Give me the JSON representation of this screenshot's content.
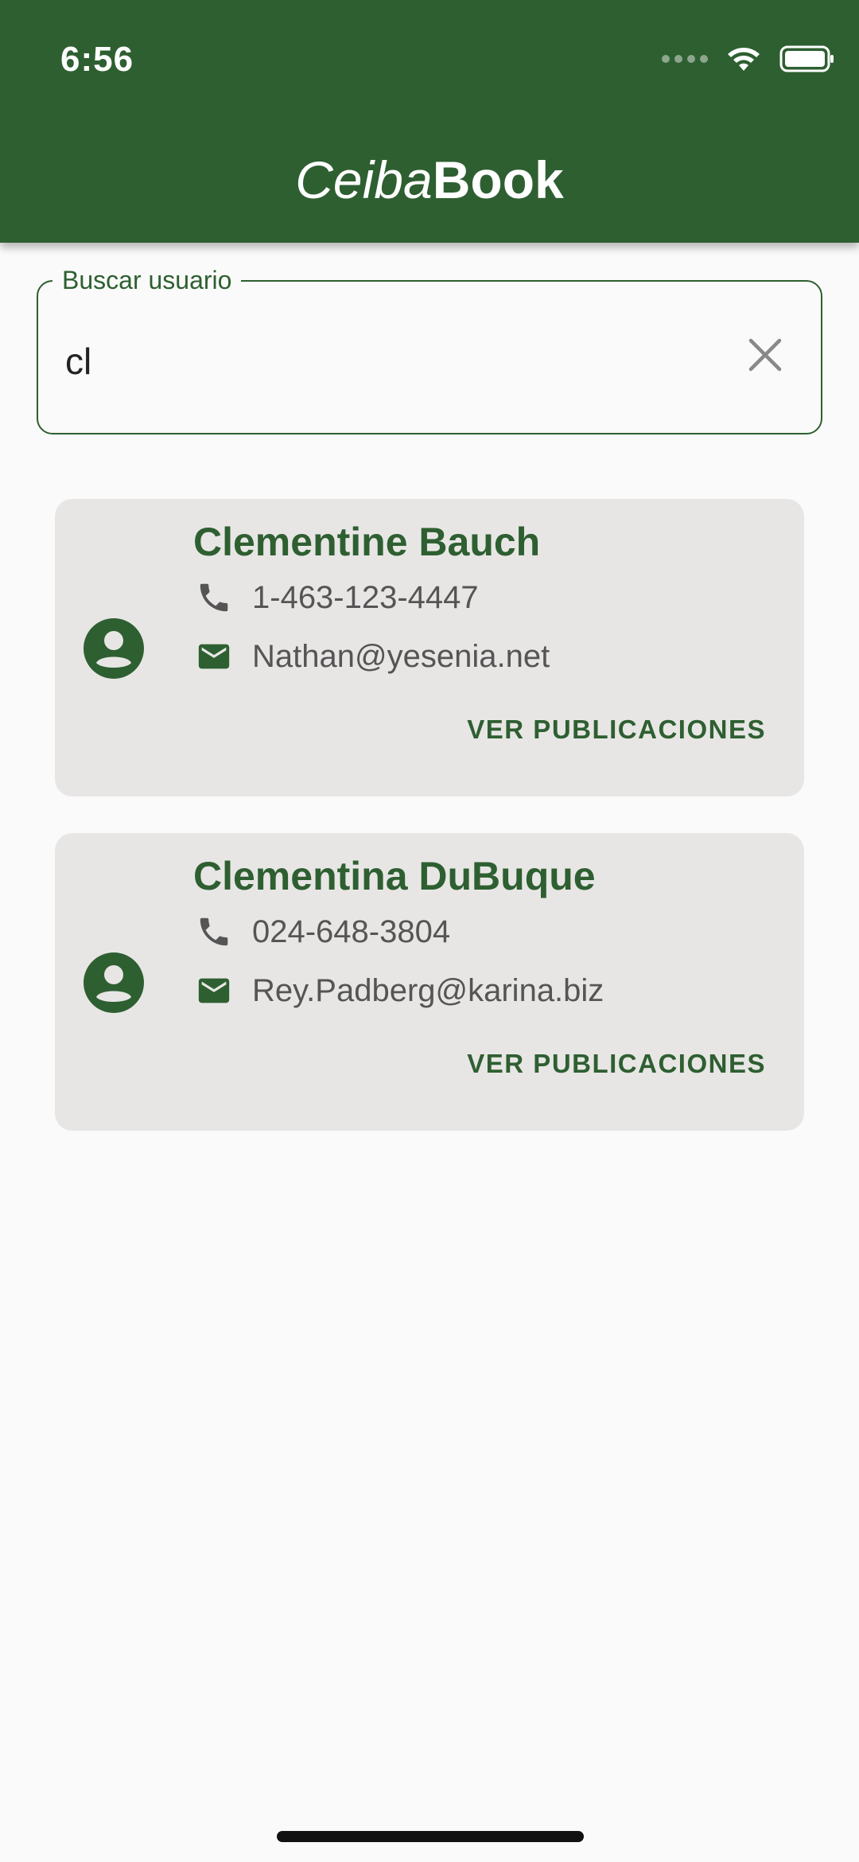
{
  "status_bar": {
    "time": "6:56"
  },
  "header": {
    "title_part_italic": "Ceiba",
    "title_part_bold": "Book"
  },
  "search": {
    "label": "Buscar usuario",
    "value": "cl"
  },
  "results": [
    {
      "name": "Clementine Bauch",
      "phone": "1-463-123-4447",
      "email": "Nathan@yesenia.net",
      "action": "VER PUBLICACIONES"
    },
    {
      "name": "Clementina DuBuque",
      "phone": "024-648-3804",
      "email": "Rey.Padberg@karina.biz",
      "action": "VER PUBLICACIONES"
    }
  ],
  "icons": {
    "avatar": "account-circle-icon",
    "phone": "phone-icon",
    "email": "mail-icon",
    "clear": "close-icon",
    "wifi": "wifi-icon",
    "battery": "battery-icon"
  },
  "colors": {
    "primary": "#2e5f31",
    "card_bg": "#e8e6e5",
    "page_bg": "#fafafa",
    "info_text": "#555555"
  }
}
